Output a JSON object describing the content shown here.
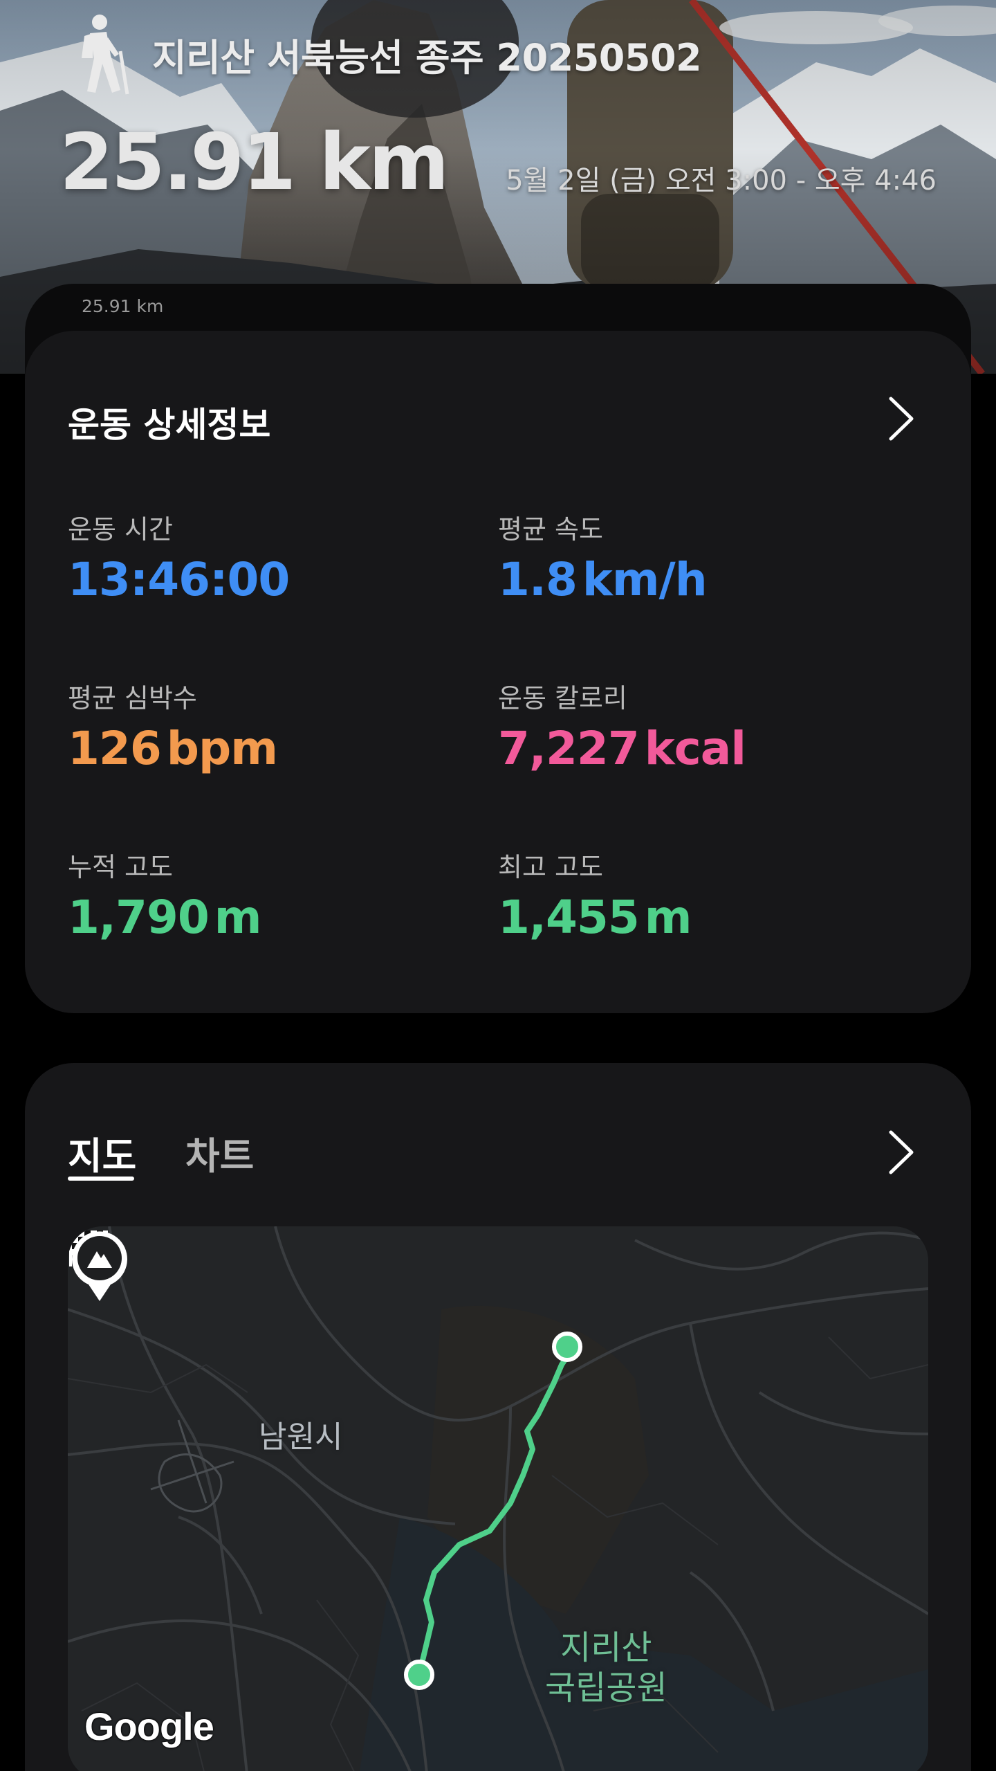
{
  "header": {
    "activity_icon": "hiker-icon",
    "title": "지리산 서북능선 종주 20250502",
    "distance": "25.91 km",
    "date_range": "5월 2일 (금) 오전 3:00 - 오후 4:46",
    "collapsed_card_label": "25.91 km"
  },
  "details": {
    "title": "운동 상세정보",
    "chevron_icon": "chevron-right-icon",
    "metrics": [
      {
        "label": "운동 시간",
        "value": "13:46:00",
        "unit": "",
        "color": "#3f8ef5"
      },
      {
        "label": "평균 속도",
        "value": "1.8",
        "unit": "km/h",
        "color": "#3f8ef5"
      },
      {
        "label": "평균 심박수",
        "value": "126",
        "unit": "bpm",
        "color": "#f39a4e"
      },
      {
        "label": "운동 칼로리",
        "value": "7,227",
        "unit": "kcal",
        "color": "#f25a9a"
      },
      {
        "label": "누적 고도",
        "value": "1,790",
        "unit": "m",
        "color": "#4fd08a"
      },
      {
        "label": "최고 고도",
        "value": "1,455",
        "unit": "m",
        "color": "#4fd08a"
      }
    ]
  },
  "map_section": {
    "tabs": [
      {
        "label": "지도",
        "active": true
      },
      {
        "label": "차트",
        "active": false
      }
    ],
    "chevron_icon": "chevron-right-icon",
    "city_label": "남원시",
    "park_label_line1": "지리산",
    "park_label_line2": "국립공원",
    "attribution": "Google",
    "route_color": "#4fd08a",
    "start_icon": "start-point-icon",
    "finish_icon": "checkered-flag-icon",
    "poi_icon": "mountain-pin-icon"
  }
}
